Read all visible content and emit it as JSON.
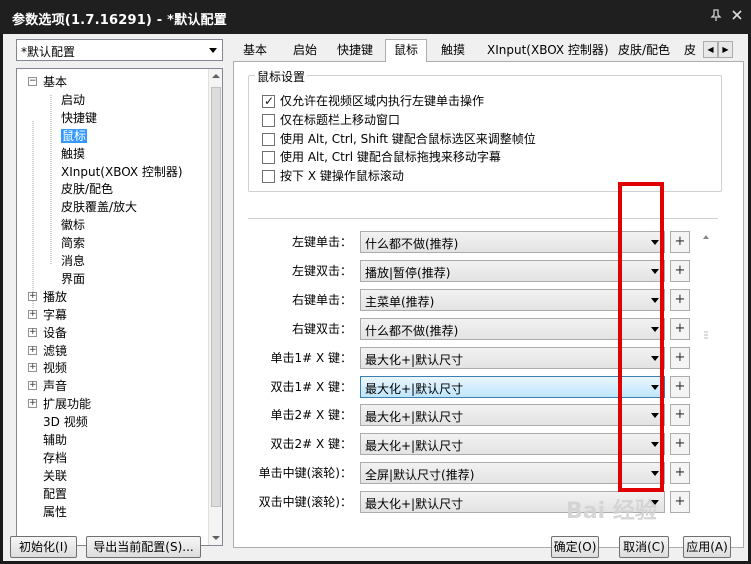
{
  "window": {
    "title": "参数选项(1.7.16291) - *默认配置",
    "pin_icon": "pin-icon",
    "close_icon": "close-icon"
  },
  "profile": {
    "selected": "*默认配置"
  },
  "tree": {
    "items": [
      {
        "label": "基本",
        "level": 0,
        "expander": "minus"
      },
      {
        "label": "启动",
        "level": 1
      },
      {
        "label": "快捷键",
        "level": 1
      },
      {
        "label": "鼠标",
        "level": 1,
        "selected": true
      },
      {
        "label": "触摸",
        "level": 1
      },
      {
        "label": "XInput(XBOX 控制器)",
        "level": 1
      },
      {
        "label": "皮肤/配色",
        "level": 1
      },
      {
        "label": "皮肤覆盖/放大",
        "level": 1
      },
      {
        "label": "徽标",
        "level": 1
      },
      {
        "label": "简索",
        "level": 1
      },
      {
        "label": "消息",
        "level": 1
      },
      {
        "label": "界面",
        "level": 1
      },
      {
        "label": "播放",
        "level": 0,
        "expander": "plus"
      },
      {
        "label": "字幕",
        "level": 0,
        "expander": "plus"
      },
      {
        "label": "设备",
        "level": 0,
        "expander": "plus"
      },
      {
        "label": "滤镜",
        "level": 0,
        "expander": "plus"
      },
      {
        "label": "视频",
        "level": 0,
        "expander": "plus"
      },
      {
        "label": "声音",
        "level": 0,
        "expander": "plus"
      },
      {
        "label": "扩展功能",
        "level": 0,
        "expander": "plus"
      },
      {
        "label": "3D 视频",
        "level": 0
      },
      {
        "label": "辅助",
        "level": 0
      },
      {
        "label": "存档",
        "level": 0
      },
      {
        "label": "关联",
        "level": 0
      },
      {
        "label": "配置",
        "level": 0
      },
      {
        "label": "属性",
        "level": 0
      }
    ]
  },
  "tabs": [
    "基本",
    "启始",
    "快捷键",
    "鼠标",
    "触摸",
    "XInput(XBOX 控制器)",
    "皮肤/配色",
    "皮"
  ],
  "active_tab": "鼠标",
  "mouse": {
    "group_title": "鼠标设置",
    "checkboxes": [
      {
        "label": "仅允许在视频区域内执行左键单击操作",
        "checked": true
      },
      {
        "label": "仅在标题栏上移动窗口",
        "checked": false
      },
      {
        "label": "使用 Alt, Ctrl, Shift 键配合鼠标选区来调整帧位",
        "checked": false
      },
      {
        "label": "使用 Alt, Ctrl 键配合鼠标拖拽来移动字幕",
        "checked": false
      },
      {
        "label": "按下 X 键操作鼠标滚动",
        "checked": false
      }
    ],
    "actions": [
      {
        "label": "左键单击：",
        "value": "什么都不做(推荐)"
      },
      {
        "label": "左键双击：",
        "value": "播放|暂停(推荐)"
      },
      {
        "label": "右键单击：",
        "value": "主菜单(推荐)"
      },
      {
        "label": "右键双击：",
        "value": "什么都不做(推荐)"
      },
      {
        "label": "单击1# X 键：",
        "value": "最大化+|默认尺寸"
      },
      {
        "label": "双击1# X 键：",
        "value": "最大化+|默认尺寸",
        "highlight": true
      },
      {
        "label": "单击2# X 键：",
        "value": "最大化+|默认尺寸"
      },
      {
        "label": "双击2# X 键：",
        "value": "最大化+|默认尺寸"
      },
      {
        "label": "单击中键(滚轮)：",
        "value": "全屏|默认尺寸(推荐)"
      },
      {
        "label": "双击中键(滚轮)：",
        "value": "最大化+|默认尺寸"
      }
    ],
    "plus_label": "+"
  },
  "buttons": {
    "init": "初始化(I)",
    "export": "导出当前配置(S)...",
    "ok": "确定(O)",
    "cancel": "取消(C)",
    "apply": "应用(A)"
  },
  "watermark": "Bai 经验",
  "colors": {
    "highlight_box": "#e00000",
    "selection": "#3399ff"
  }
}
